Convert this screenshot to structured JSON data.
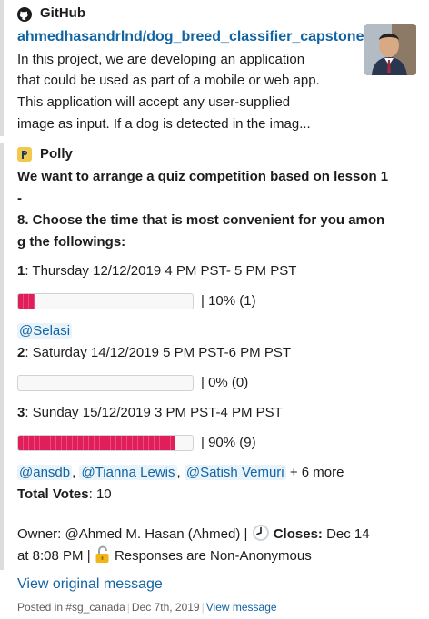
{
  "colors": {
    "accent": "#e01e5a",
    "link": "#1264a3",
    "mention_bg": "#e8f3fa"
  },
  "github": {
    "icon": "github-icon",
    "name": "GitHub",
    "repo": "ahmedhasandrlnd/dog_breed_classifier_capstone",
    "description_lines": [
      "In this project, we are developing an application",
      "that could be used as part of a mobile or web app.",
      "This application will accept any user-supplied",
      "image as input. If a dog is detected in the imag..."
    ]
  },
  "polly": {
    "icon": "polly-icon",
    "name": "Polly",
    "question_lines": [
      "We want to arrange a quiz competition based on lesson 1",
      "-",
      "8. Choose the time that is most convenient for you amon",
      "g the followings:"
    ],
    "options": [
      {
        "number": "1",
        "text": ": Thursday 12/12/2019 4 PM PST- 5 PM PST",
        "percent": 0.1,
        "result": "|  10% (1)",
        "voters": [
          "@Selasi"
        ],
        "more": ""
      },
      {
        "number": "2",
        "text": ": Saturday 14/12/2019 5 PM PST-6 PM PST",
        "percent": 0.0,
        "result": "|  0% (0)",
        "voters": [],
        "more": ""
      },
      {
        "number": "3",
        "text": ": Sunday 15/12/2019 3 PM PST-4 PM PST",
        "percent": 0.9,
        "result": "|  90% (9)",
        "voters": [
          "@ansdb",
          "@Tianna Lewis",
          "@Satish Vemuri"
        ],
        "more": "+ 6 more"
      }
    ],
    "total_label": "Total Votes",
    "total_value": ": 10",
    "owner_text": "Owner: @Ahmed M. Hasan (Ahmed)  |",
    "closes_label": "Closes:",
    "closes_value": " Dec 14",
    "closes_time": "at 8:08 PM  |",
    "anonymity": "Responses are Non-Anonymous",
    "view_original": "View original message"
  },
  "footer": {
    "posted_in": "Posted in #sg_canada",
    "date": "Dec 7th, 2019",
    "view_message": "View message"
  }
}
